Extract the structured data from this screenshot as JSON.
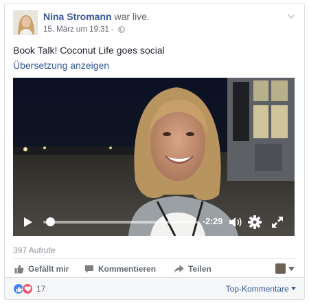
{
  "post": {
    "author_name": "Nina Stromann",
    "status_text": "war live.",
    "timestamp": "15. März um 19:31 ·",
    "text": "Book Talk! Coconut Life goes social",
    "translate_link": "Übersetzung anzeigen",
    "privacy_icon": "globe-icon",
    "menu_icon": "chevron-down-icon"
  },
  "video": {
    "remaining_time": "-2:29",
    "progress": 0.02,
    "icons": [
      "play-icon",
      "volume-icon",
      "gear-icon",
      "fullscreen-icon"
    ]
  },
  "stats": {
    "views": "397 Aufrufe",
    "reaction_count": "17"
  },
  "actions": {
    "like": "Gefällt mir",
    "comment": "Kommentieren",
    "share": "Teilen"
  },
  "footer": {
    "sort_label": "Top-Kommentare"
  },
  "colors": {
    "link": "#365899",
    "like_blue": "#4080ff",
    "love_red": "#f25268",
    "secondary_text": "#616770"
  }
}
